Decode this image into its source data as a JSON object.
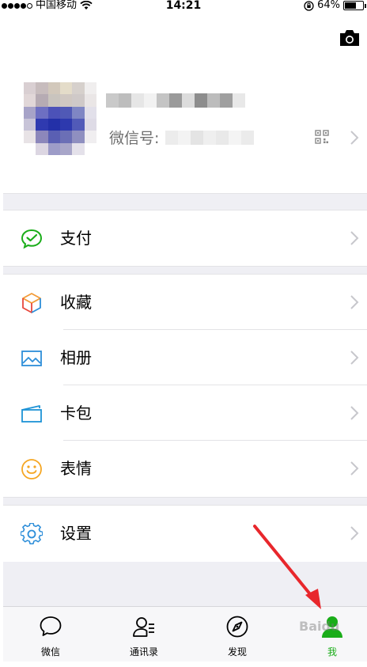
{
  "status_bar": {
    "carrier": "中国移动",
    "time": "14:21",
    "battery": "64%",
    "battery_level": 0.64
  },
  "profile": {
    "wechat_id_label": "微信号:"
  },
  "menu": {
    "pay": "支付",
    "favorites": "收藏",
    "album": "相册",
    "cards": "卡包",
    "stickers": "表情",
    "settings": "设置"
  },
  "tabs": [
    {
      "label": "微信",
      "icon": "chat-bubble-icon"
    },
    {
      "label": "通讯录",
      "icon": "contacts-icon"
    },
    {
      "label": "发现",
      "icon": "compass-icon"
    },
    {
      "label": "我",
      "icon": "me-icon",
      "active": true
    }
  ],
  "colors": {
    "accent_green": "#1aad19",
    "pay_green": "#1aad19",
    "favorites_orange": "#f29b38",
    "album_blue": "#2d8ed9",
    "cards_blue": "#1e93d6",
    "stickers_orange": "#f5a623",
    "settings_blue": "#2d8ed9",
    "annotation_red": "#e8272c",
    "background_gray": "#efeff4"
  }
}
